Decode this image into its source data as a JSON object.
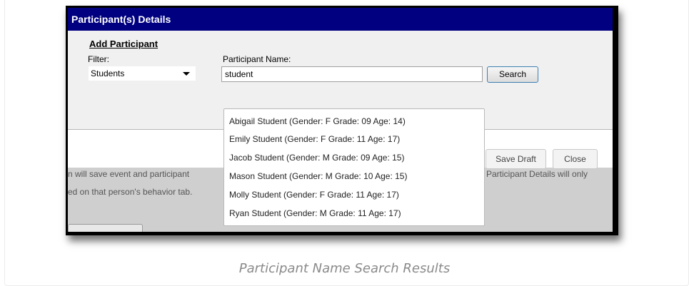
{
  "dialog": {
    "title": "Participant(s) Details",
    "add_participant_label": "Add Participant",
    "filter_label": "Filter:",
    "filter_value": "Students",
    "participant_name_label": "Participant Name:",
    "participant_name_value": "student",
    "search_label": "Search",
    "save_draft_label": "Save Draft",
    "close_label": "Close",
    "help_line_1_left": "n will save event and participant",
    "help_line_1_right": "Participant Details will only",
    "help_line_2": "ed on that person's behavior tab."
  },
  "results": [
    "Abigail Student (Gender: F Grade: 09 Age: 14)",
    "Emily Student (Gender: F Grade: 11 Age: 17)",
    "Jacob Student (Gender: M Grade: 09 Age: 15)",
    "Mason Student (Gender: M Grade: 10 Age: 15)",
    "Molly Student (Gender: F Grade: 11 Age: 17)",
    "Ryan Student (Gender: M Grade: 11 Age: 17)"
  ],
  "caption": "Participant Name Search Results",
  "colors": {
    "title_bar": "#000080",
    "panel": "#f0f0f0",
    "search_border": "#3c7fb1"
  }
}
